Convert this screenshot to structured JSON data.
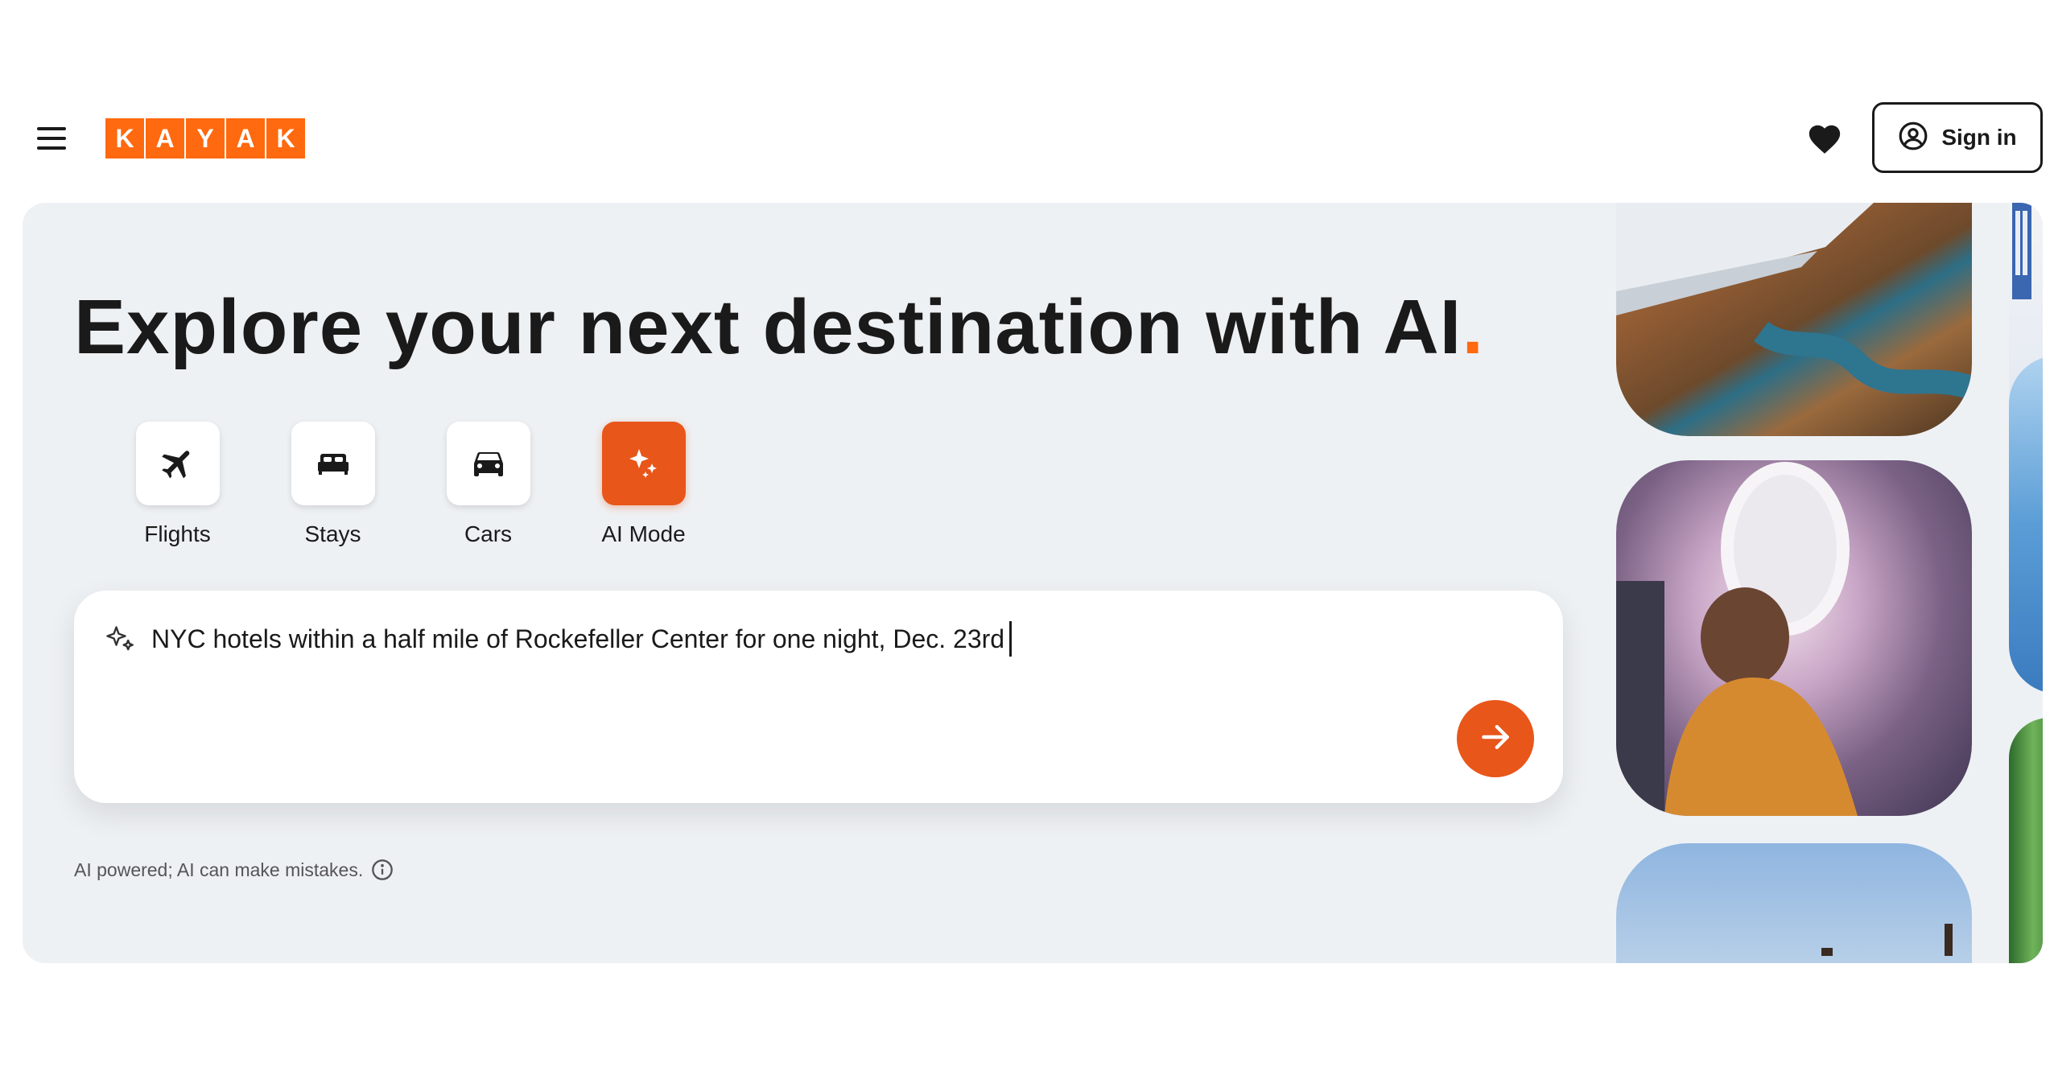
{
  "header": {
    "menu_icon": "hamburger-menu-icon",
    "logo_letters": [
      "K",
      "A",
      "Y",
      "A",
      "K"
    ],
    "favorites_icon": "heart-icon",
    "sign_in_label": "Sign in",
    "sign_in_icon": "user-circle-icon"
  },
  "hero": {
    "title": "Explore your next destination with AI",
    "title_dot": ".",
    "modes": [
      {
        "label": "Flights",
        "icon": "airplane-icon",
        "active": false
      },
      {
        "label": "Stays",
        "icon": "bed-icon",
        "active": false
      },
      {
        "label": "Cars",
        "icon": "car-icon",
        "active": false
      },
      {
        "label": "AI Mode",
        "icon": "sparkle-icon",
        "active": true
      }
    ],
    "search": {
      "icon": "sparkle-icon",
      "query": "NYC hotels within a half mile of Rockefeller Center for one night, Dec. 23rd",
      "submit_icon": "arrow-right-icon"
    },
    "disclaimer": "AI powered; AI can make mistakes.",
    "disclaimer_icon": "info-icon"
  },
  "colors": {
    "brand_orange": "#ff690f",
    "accent_orange": "#e8561a",
    "hero_background": "#eef1f4",
    "text": "#1a1a1a"
  }
}
